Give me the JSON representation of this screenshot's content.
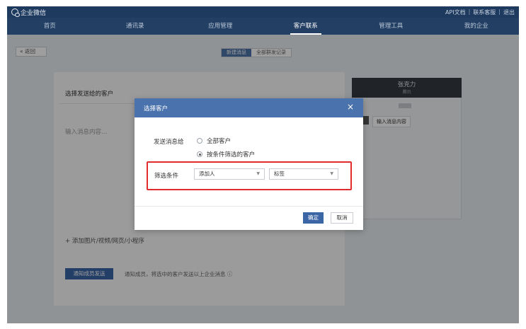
{
  "topbar": {
    "brand": "企业微信",
    "links": [
      "API文档",
      "联系客服",
      "退出"
    ],
    "separator": "|"
  },
  "nav": {
    "items": [
      "首页",
      "通讯录",
      "应用管理",
      "客户联系",
      "管理工具",
      "我的企业"
    ],
    "active_index": 3
  },
  "toolbar": {
    "back_label": "« 返回",
    "tabs": [
      "新建消息",
      "全部群发记录"
    ],
    "active_tab": 0
  },
  "compose": {
    "title": "选择发送给的客户",
    "message_placeholder": "输入消息内容…",
    "attach_label": "+  添加图片/视频/网页/小程序",
    "send_button": "通知成员发送",
    "send_hint": "通知成员，将选中的客户发送以上企业消息 ⓘ"
  },
  "preview": {
    "name": "张克力",
    "subtitle": "腾讯",
    "bubble": "输入消息内容"
  },
  "modal": {
    "title": "选择客户",
    "close": "×",
    "send_to_label": "发送消息给",
    "options": [
      "全部客户",
      "按条件筛选的客户"
    ],
    "selected_option": 1,
    "filter_label": "筛选条件",
    "filter_adder_value": "添加人",
    "filter_tag_value": "标签",
    "dropdown_arrow": "▼",
    "ok_button": "确定",
    "cancel_button": "取消",
    "highlight_color": "#e02c2c"
  }
}
